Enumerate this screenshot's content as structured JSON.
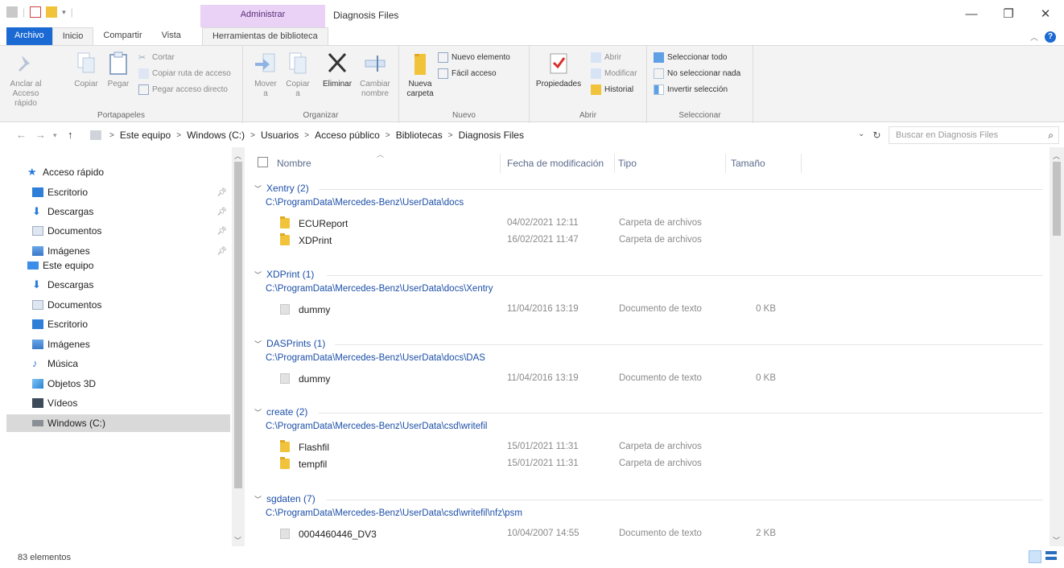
{
  "window": {
    "title": "Diagnosis Files",
    "context_group": "Administrar",
    "controls": {
      "minimize": "—",
      "maximize": "❐",
      "close": "✕"
    }
  },
  "ribbon_tabs": {
    "file": "Archivo",
    "home": "Inicio",
    "share": "Compartir",
    "view": "Vista",
    "library_tools": "Herramientas de biblioteca"
  },
  "ribbon": {
    "clipboard": {
      "label": "Portapapeles",
      "pin": "Anclar al Acceso rápido",
      "copy": "Copiar",
      "paste": "Pegar",
      "cut": "Cortar",
      "copy_path": "Copiar ruta de acceso",
      "paste_shortcut": "Pegar acceso directo"
    },
    "organize": {
      "label": "Organizar",
      "move": "Mover a",
      "copy": "Copiar a",
      "delete": "Eliminar",
      "rename": "Cambiar nombre"
    },
    "new": {
      "label": "Nuevo",
      "new_folder": "Nueva carpeta",
      "new_item": "Nuevo elemento",
      "easy_access": "Fácil acceso"
    },
    "open": {
      "label": "Abrir",
      "properties": "Propiedades",
      "open": "Abrir",
      "edit": "Modificar",
      "history": "Historial"
    },
    "select": {
      "label": "Seleccionar",
      "select_all": "Seleccionar todo",
      "select_none": "No seleccionar nada",
      "invert": "Invertir selección"
    }
  },
  "address": {
    "crumbs": [
      "Este equipo",
      "Windows (C:)",
      "Usuarios",
      "Acceso público",
      "Bibliotecas",
      "Diagnosis Files"
    ],
    "search_placeholder": "Buscar en Diagnosis Files"
  },
  "nav": {
    "quick_access": "Acceso rápido",
    "quick_items": [
      "Escritorio",
      "Descargas",
      "Documentos",
      "Imágenes"
    ],
    "this_pc": "Este equipo",
    "pc_items": [
      "Descargas",
      "Documentos",
      "Escritorio",
      "Imágenes",
      "Música",
      "Objetos 3D",
      "Vídeos",
      "Windows (C:)"
    ]
  },
  "columns": {
    "name": "Nombre",
    "date": "Fecha de modificación",
    "type": "Tipo",
    "size": "Tamaño"
  },
  "groups": [
    {
      "title": "Xentry (2)",
      "path": "C:\\ProgramData\\Mercedes-Benz\\UserData\\docs",
      "items": [
        {
          "name": "ECUReport",
          "date": "04/02/2021 12:11",
          "type": "Carpeta de archivos",
          "size": "",
          "kind": "folder"
        },
        {
          "name": "XDPrint",
          "date": "16/02/2021 11:47",
          "type": "Carpeta de archivos",
          "size": "",
          "kind": "folder"
        }
      ]
    },
    {
      "title": "XDPrint (1)",
      "path": "C:\\ProgramData\\Mercedes-Benz\\UserData\\docs\\Xentry",
      "items": [
        {
          "name": "dummy",
          "date": "11/04/2016 13:19",
          "type": "Documento de texto",
          "size": "0 KB",
          "kind": "file"
        }
      ]
    },
    {
      "title": "DASPrints (1)",
      "path": "C:\\ProgramData\\Mercedes-Benz\\UserData\\docs\\DAS",
      "items": [
        {
          "name": "dummy",
          "date": "11/04/2016 13:19",
          "type": "Documento de texto",
          "size": "0 KB",
          "kind": "file"
        }
      ]
    },
    {
      "title": "create (2)",
      "path": "C:\\ProgramData\\Mercedes-Benz\\UserData\\csd\\writefil",
      "items": [
        {
          "name": "Flashfil",
          "date": "15/01/2021 11:31",
          "type": "Carpeta de archivos",
          "size": "",
          "kind": "folder"
        },
        {
          "name": "tempfil",
          "date": "15/01/2021 11:31",
          "type": "Carpeta de archivos",
          "size": "",
          "kind": "folder"
        }
      ]
    },
    {
      "title": "sgdaten (7)",
      "path": "C:\\ProgramData\\Mercedes-Benz\\UserData\\csd\\writefil\\nfz\\psm",
      "items": [
        {
          "name": "0004460446_DV3",
          "date": "10/04/2007 14:55",
          "type": "Documento de texto",
          "size": "2 KB",
          "kind": "file"
        }
      ]
    }
  ],
  "status": {
    "count": "83 elementos"
  },
  "colors": {
    "accent": "#1b6ad4",
    "context": "#e9d2f5",
    "group_text": "#1c4fa8"
  }
}
